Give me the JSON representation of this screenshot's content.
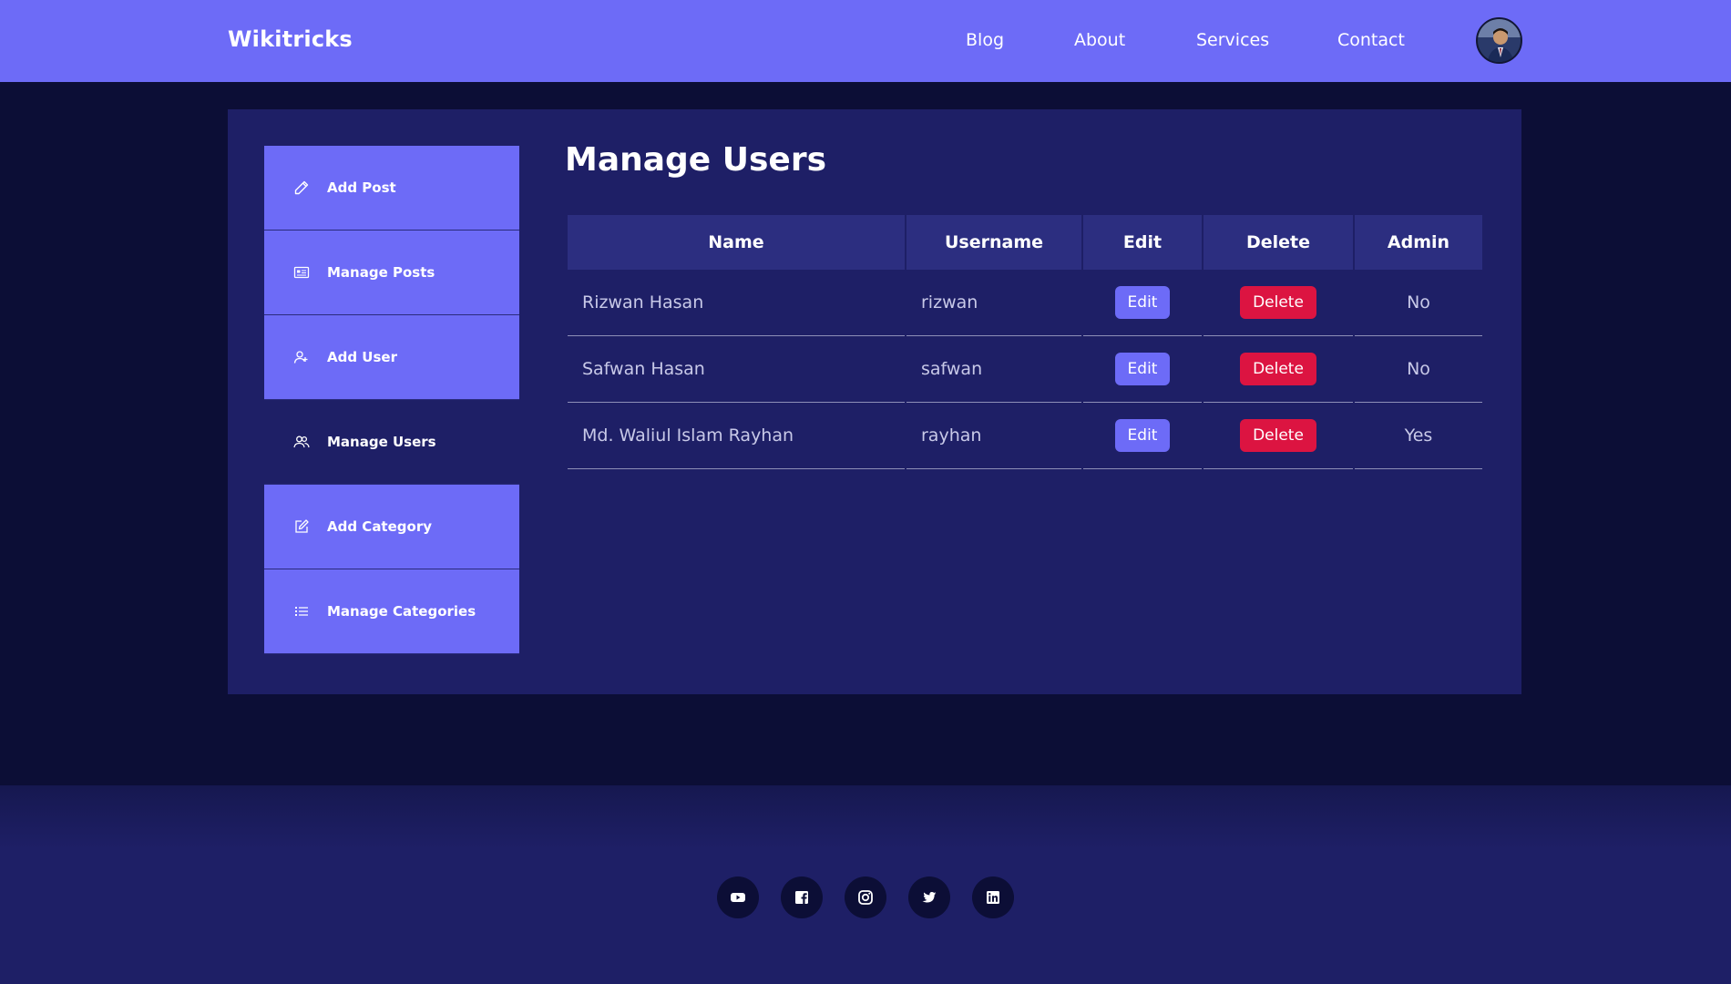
{
  "header": {
    "brand": "Wikitricks",
    "nav": [
      "Blog",
      "About",
      "Services",
      "Contact"
    ]
  },
  "sidebar": {
    "items": [
      {
        "label": "Add Post",
        "icon": "pencil-icon"
      },
      {
        "label": "Manage Posts",
        "icon": "posts-icon"
      },
      {
        "label": "Add User",
        "icon": "add-user-icon"
      },
      {
        "label": "Manage Users",
        "icon": "users-icon",
        "active": true
      },
      {
        "label": "Add Category",
        "icon": "edit-square-icon"
      },
      {
        "label": "Manage Categories",
        "icon": "list-icon"
      }
    ]
  },
  "main": {
    "title": "Manage Users",
    "table": {
      "headers": [
        "Name",
        "Username",
        "Edit",
        "Delete",
        "Admin"
      ],
      "rows": [
        {
          "name": "Rizwan Hasan",
          "username": "rizwan",
          "edit": "Edit",
          "delete": "Delete",
          "admin": "No"
        },
        {
          "name": "Safwan Hasan",
          "username": "safwan",
          "edit": "Edit",
          "delete": "Delete",
          "admin": "No"
        },
        {
          "name": "Md. Waliul Islam Rayhan",
          "username": "rayhan",
          "edit": "Edit",
          "delete": "Delete",
          "admin": "Yes"
        }
      ]
    }
  },
  "footer": {
    "social": [
      "youtube-icon",
      "facebook-icon",
      "instagram-icon",
      "twitter-icon",
      "linkedin-icon"
    ]
  },
  "colors": {
    "background": "#0c0e36",
    "navbar": "#6d6bf7",
    "panel": "#1e1f66",
    "delete": "#dc1441"
  }
}
